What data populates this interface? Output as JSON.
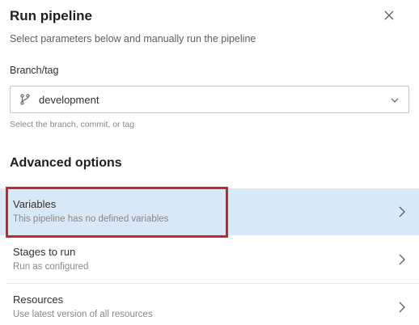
{
  "dialog": {
    "title": "Run pipeline",
    "subtitle": "Select parameters below and manually run the pipeline",
    "close_icon": "close-icon"
  },
  "branch": {
    "label": "Branch/tag",
    "value": "development",
    "icon": "branch-icon",
    "helper": "Select the branch, commit, or tag"
  },
  "advanced": {
    "title": "Advanced options",
    "items": [
      {
        "title": "Variables",
        "description": "This pipeline has no defined variables",
        "selected": true
      },
      {
        "title": "Stages to run",
        "description": "Run as configured",
        "selected": false
      },
      {
        "title": "Resources",
        "description": "Use latest version of all resources",
        "selected": false
      }
    ]
  },
  "colors": {
    "selected_row": "#d9e8f6",
    "highlight_border": "#c4262e",
    "text_primary": "#201f1e",
    "text_secondary": "#605e5c"
  }
}
